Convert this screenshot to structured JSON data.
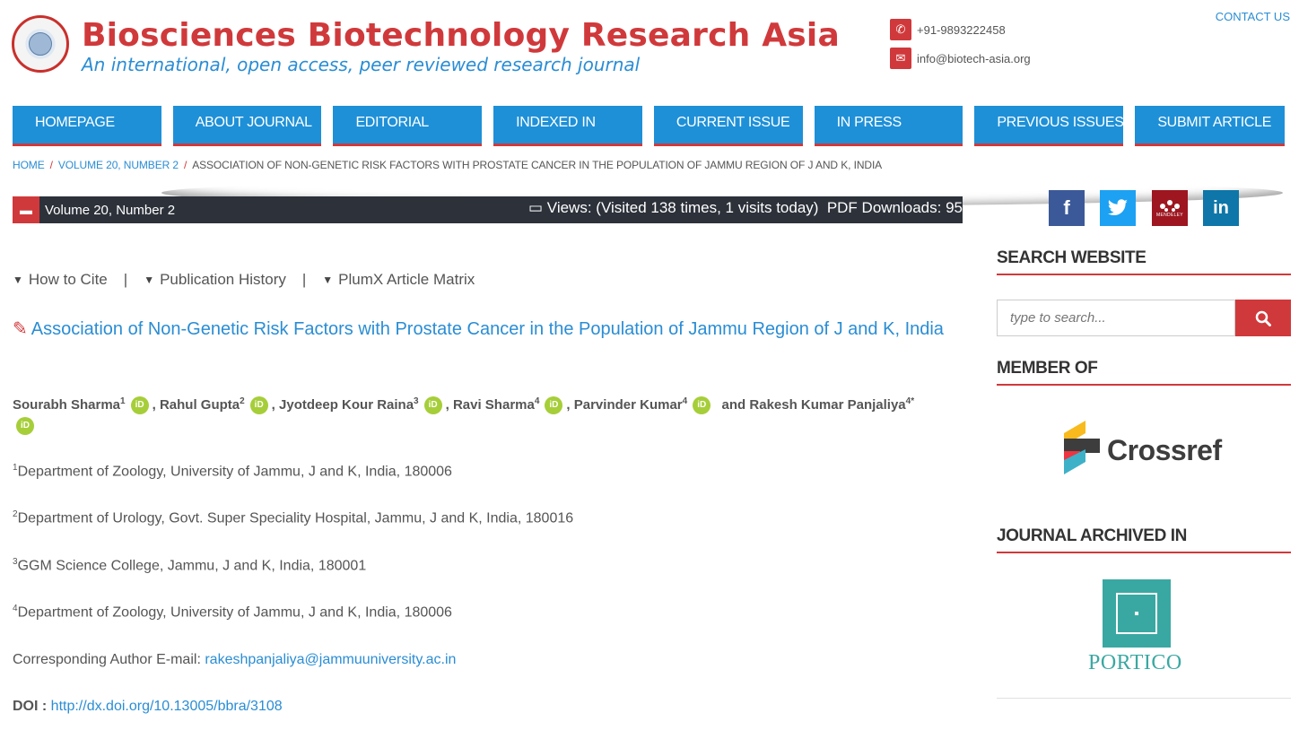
{
  "header": {
    "title": "Biosciences Biotechnology Research Asia",
    "tagline": "An international, open access, peer reviewed research journal",
    "phone": "+91-9893222458",
    "email": "info@biotech-asia.org",
    "contact_link": "CONTACT US",
    "phone_icon": "phone-icon",
    "email_icon": "envelope-icon"
  },
  "nav": {
    "items": [
      "HOMEPAGE",
      "ABOUT JOURNAL",
      "EDITORIAL",
      "INDEXED IN",
      "CURRENT ISSUE",
      "IN PRESS",
      "PREVIOUS ISSUES",
      "SUBMIT ARTICLE"
    ]
  },
  "breadcrumb": {
    "home": "HOME",
    "volume": "VOLUME 20, NUMBER 2",
    "current": "ASSOCIATION OF NON-GENETIC RISK FACTORS WITH PROSTATE CANCER IN THE POPULATION OF JAMMU REGION OF J AND K, INDIA"
  },
  "infobar": {
    "volume": "Volume 20, Number 2",
    "views": "Views: (Visited 138 times, 1 visits today)",
    "pdf_downloads": "PDF Downloads: 95"
  },
  "social": {
    "facebook": "f",
    "twitter": "🐦",
    "mendeley": "MENDELEY",
    "linkedin": "in"
  },
  "tabs": {
    "cite": "How to Cite",
    "history": "Publication History",
    "plumx": "PlumX Article Matrix"
  },
  "article": {
    "title": "Association of Non-Genetic Risk Factors with Prostate Cancer in the Population of Jammu Region of J and K, India",
    "authors": [
      {
        "name": "Sourabh Sharma",
        "sup": "1"
      },
      {
        "name": "Rahul Gupta",
        "sup": "2"
      },
      {
        "name": "Jyotdeep Kour Raina",
        "sup": "3"
      },
      {
        "name": "Ravi Sharma",
        "sup": "4"
      },
      {
        "name": "Parvinder Kumar",
        "sup": "4"
      },
      {
        "name": "Rakesh Kumar Panjaliya",
        "sup": "4*"
      }
    ],
    "and_word": "and",
    "orcid_label": "iD",
    "affiliations": [
      {
        "sup": "1",
        "text": "Department of Zoology, University of Jammu, J and K, India, 180006"
      },
      {
        "sup": "2",
        "text": "Department of Urology, Govt. Super Speciality Hospital, Jammu, J and K, India, 180016"
      },
      {
        "sup": "3",
        "text": "GGM Science College, Jammu, J and K, India, 180001"
      },
      {
        "sup": "4",
        "text": "Department of Zoology, University of Jammu, J and K, India, 180006"
      }
    ],
    "corresponding_label": "Corresponding Author E-mail:",
    "corresponding_email": "rakeshpanjaliya@jammuuniversity.ac.in",
    "doi_label": "DOI :",
    "doi_url": "http://dx.doi.org/10.13005/bbra/3108"
  },
  "sidebar": {
    "search_heading": "SEARCH WEBSITE",
    "search_placeholder": "type to search...",
    "member_heading": "MEMBER OF",
    "crossref": "Crossref",
    "archived_heading": "JOURNAL ARCHIVED IN",
    "portico": "PORTICO"
  },
  "colors": {
    "brand_red": "#d0393b",
    "brand_blue": "#1e90d8",
    "link_blue": "#2a8dd4",
    "facebook": "#3b5998",
    "twitter": "#1da1f2",
    "mendeley": "#9d1620",
    "linkedin": "#0e76a8",
    "orcid": "#a6ce39",
    "portico": "#3aa8a2"
  }
}
